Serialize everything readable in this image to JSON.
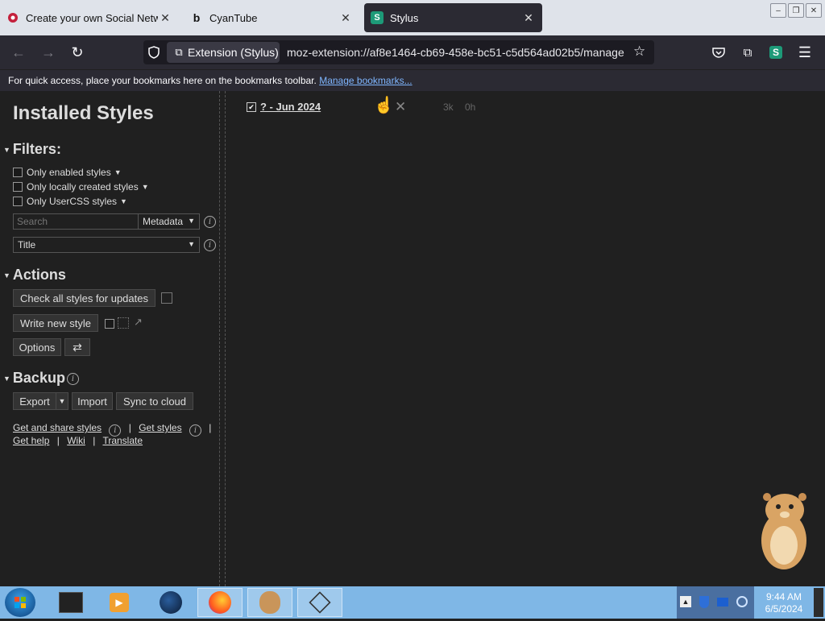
{
  "browser": {
    "tabs": [
      {
        "title": "Create your own Social Network",
        "favicon": "social-network-favicon",
        "active": false
      },
      {
        "title": "CyanTube",
        "favicon": "cyantube-favicon",
        "active": false
      },
      {
        "title": "Stylus",
        "favicon": "stylus-favicon",
        "active": true
      }
    ],
    "identity_label": "Extension (Stylus)",
    "url": "moz-extension://af8e1464-cb69-458e-bc51-c5d564ad02b5/manage",
    "bookmarks_notice": "For quick access, place your bookmarks here on the bookmarks toolbar.",
    "manage_bookmarks": "Manage bookmarks..."
  },
  "stylus": {
    "title": "Installed Styles",
    "filters": {
      "heading": "Filters:",
      "checkboxes": [
        "Only enabled styles",
        "Only locally created styles",
        "Only UserCSS styles"
      ],
      "search_placeholder": "Search",
      "search_mode": "Metadata",
      "sort": "Title"
    },
    "actions": {
      "heading": "Actions",
      "check_updates": "Check all styles for updates",
      "write_new": "Write new style",
      "options": "Options"
    },
    "backup": {
      "heading": "Backup",
      "export": "Export",
      "import": "Import",
      "sync": "Sync to cloud"
    },
    "links": {
      "get_and_share": "Get and share styles",
      "get_styles": "Get styles",
      "get_help": "Get help",
      "wiki": "Wiki",
      "translate": "Translate",
      "separator": "|"
    },
    "styles": [
      {
        "name": "? - Jun 2024",
        "enabled": true,
        "size": "3k",
        "age": "0h"
      }
    ]
  },
  "taskbar": {
    "time": "9:44 AM",
    "date": "6/5/2024",
    "items": [
      "terminal-app-icon",
      "media-player-icon",
      "globe-app-icon",
      "firefox-icon",
      "hamster-app-icon",
      "unity-app-icon"
    ]
  },
  "colors": {
    "accent_link": "#7fb6ff",
    "tab_active_bg": "#2b2a33",
    "taskbar_bg": "#7fb7e6"
  }
}
